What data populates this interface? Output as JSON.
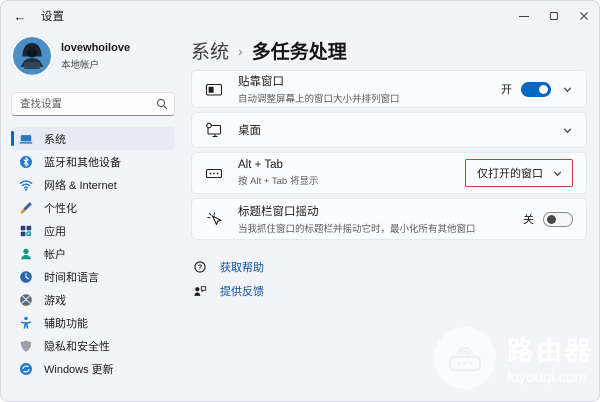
{
  "titlebar": {
    "title": "设置"
  },
  "account": {
    "name": "lovewhoilove",
    "type": "本地帐户"
  },
  "search": {
    "placeholder": "查找设置"
  },
  "sidebar": {
    "items": [
      {
        "label": "系统",
        "icon": "system-laptop-icon",
        "selected": true
      },
      {
        "label": "蓝牙和其他设备",
        "icon": "bluetooth-icon",
        "selected": false
      },
      {
        "label": "网络 & Internet",
        "icon": "wifi-icon",
        "selected": false
      },
      {
        "label": "个性化",
        "icon": "personalization-brush-icon",
        "selected": false
      },
      {
        "label": "应用",
        "icon": "apps-grid-icon",
        "selected": false
      },
      {
        "label": "帐户",
        "icon": "account-person-icon",
        "selected": false
      },
      {
        "label": "时间和语言",
        "icon": "time-language-icon",
        "selected": false
      },
      {
        "label": "游戏",
        "icon": "gaming-xbox-icon",
        "selected": false
      },
      {
        "label": "辅助功能",
        "icon": "accessibility-icon",
        "selected": false
      },
      {
        "label": "隐私和安全性",
        "icon": "privacy-shield-icon",
        "selected": false
      },
      {
        "label": "Windows 更新",
        "icon": "windows-update-icon",
        "selected": false
      }
    ]
  },
  "breadcrumb": {
    "parent": "系统",
    "separator": "›",
    "current": "多任务处理"
  },
  "cards": [
    {
      "title": "贴靠窗口",
      "subtitle": "自动调整屏幕上的窗口大小并排列窗口",
      "icon": "snap-windows-icon",
      "toggle_label": "开",
      "toggle_state": "on",
      "expandable": true
    },
    {
      "title": "桌面",
      "icon": "desktops-icon",
      "expandable": true
    },
    {
      "title": "Alt + Tab",
      "subtitle": "按 Alt + Tab 将显示",
      "icon": "alt-tab-icon",
      "dropdown_value": "仅打开的窗口",
      "annotated": true
    },
    {
      "title": "标题栏窗口摇动",
      "subtitle": "当我抓住窗口的标题栏并摇动它时，最小化所有其他窗口",
      "icon": "shake-window-icon",
      "toggle_label": "关",
      "toggle_state": "off"
    }
  ],
  "links": [
    {
      "label": "获取帮助",
      "icon": "get-help-icon"
    },
    {
      "label": "提供反馈",
      "icon": "feedback-icon"
    }
  ],
  "watermark": {
    "title": "路由器",
    "domain": "luyouqi.com",
    "icon": "router-icon"
  },
  "colors": {
    "accent": "#0067c4",
    "link": "#10509e",
    "annotation": "#c5403c"
  }
}
